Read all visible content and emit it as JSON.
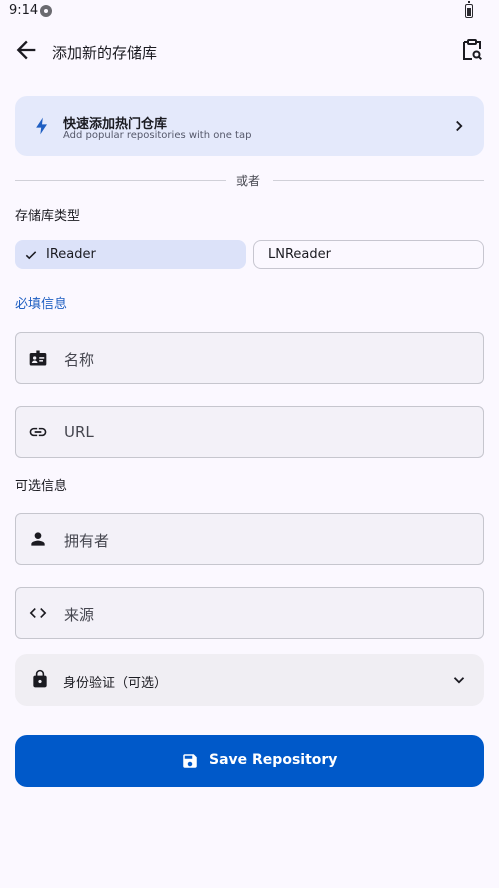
{
  "status_bar": {
    "time": "9:14"
  },
  "header": {
    "title": "添加新的存储库"
  },
  "quick_add": {
    "title": "快速添加热门仓库",
    "subtitle": "Add popular repositories with one tap"
  },
  "divider": {
    "text": "或者"
  },
  "repo_type": {
    "label": "存储库类型",
    "options": [
      {
        "label": "IReader",
        "selected": true
      },
      {
        "label": "LNReader",
        "selected": false
      }
    ]
  },
  "required": {
    "label": "必填信息",
    "name_placeholder": "名称",
    "url_placeholder": "URL"
  },
  "optional": {
    "label": "可选信息",
    "owner_placeholder": "拥有者",
    "source_placeholder": "来源"
  },
  "auth": {
    "label": "身份验证（可选）"
  },
  "save": {
    "label": "Save Repository"
  },
  "colors": {
    "accent": "#0059c9",
    "chip_selected": "#dce2f9",
    "quick_add_bg": "#e4e9fb",
    "section_accent": "#1f5fc2"
  }
}
